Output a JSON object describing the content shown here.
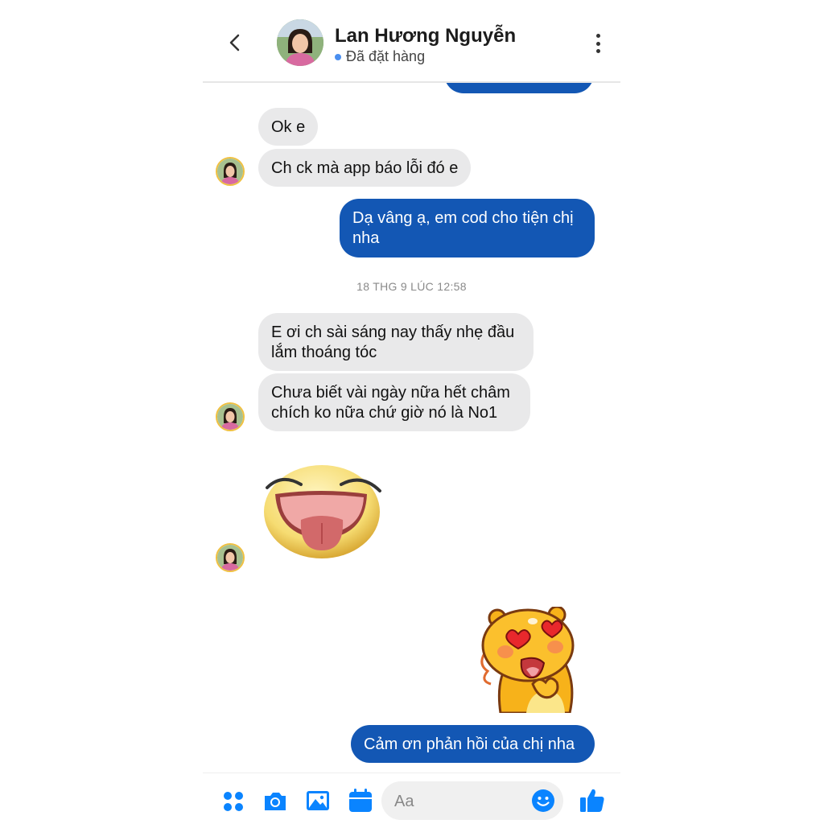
{
  "header": {
    "contact_name": "Lan Hương Nguyễn",
    "status": "Đã đặt hàng"
  },
  "messages": [
    {
      "sender": "contact",
      "text": "Ok e"
    },
    {
      "sender": "contact",
      "text": "Ch ck mà app báo lỗi đó e"
    },
    {
      "sender": "me",
      "text_line1": "Dạ vâng ạ, em cod cho tiện chị",
      "text_line2": "nha"
    },
    {
      "sender": "contact",
      "text_line1": "E ơi ch sài sáng nay thấy nhẹ đầu",
      "text_line2": "lắm thoáng tóc"
    },
    {
      "sender": "contact",
      "text_line1": "Chưa biết vài ngày nữa hết châm",
      "text_line2": "chích ko nữa chứ giờ nó là No1"
    },
    {
      "sender": "contact",
      "sticker": "laughing-tongue-face-sticker"
    },
    {
      "sender": "me",
      "sticker": "heart-eyes-bear-sticker"
    },
    {
      "sender": "me",
      "text": "Cảm ơn phản hồi của chị nha"
    }
  ],
  "timestamp": "18 THG 9 LÚC 12:58",
  "composer": {
    "placeholder": "Aa",
    "icons": [
      "apps-icon",
      "camera-icon",
      "image-icon",
      "calendar-icon",
      "emoji-icon",
      "thumbs-up-icon"
    ]
  },
  "colors": {
    "outgoing_bubble": "#1357b4",
    "incoming_bubble": "#e9e9ea",
    "accent": "#0a84ff"
  }
}
